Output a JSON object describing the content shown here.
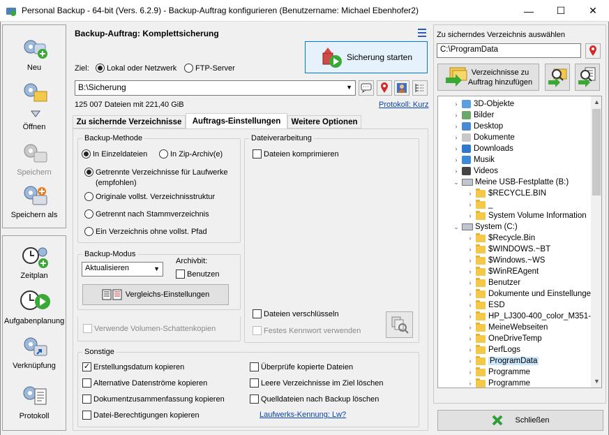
{
  "window": {
    "title": "Personal Backup - 64-bit (Vers. 6.2.9) - Backup-Auftrag konfigurieren (Benutzername: Michael Ebenhofer2)",
    "minimize": "—",
    "maximize": "☐",
    "close": "✕"
  },
  "sidebar": {
    "top": [
      {
        "label": "Neu",
        "icon": "new-job-icon"
      },
      {
        "label": "Öffnen",
        "icon": "open-job-icon"
      },
      {
        "label": "Speichern",
        "icon": "save-icon",
        "disabled": true
      },
      {
        "label": "Speichern als",
        "icon": "save-as-icon"
      }
    ],
    "bottom": [
      {
        "label": "Zeitplan",
        "icon": "schedule-icon"
      },
      {
        "label": "Aufgabenplanung",
        "icon": "task-scheduler-icon"
      },
      {
        "label": "Verknüpfung",
        "icon": "shortcut-icon"
      },
      {
        "label": "Protokoll",
        "icon": "log-icon"
      }
    ]
  },
  "job": {
    "title": "Backup-Auftrag: Komplettsicherung",
    "start_label": "Sicherung starten",
    "target_label": "Ziel:",
    "target_local": "Lokal oder Netzwerk",
    "target_ftp": "FTP-Server",
    "target_path": "B:\\Sicherung",
    "stats": "125 007 Dateien mit 221,40 GiB",
    "log_link": "Protokoll: Kurz"
  },
  "tabs": [
    {
      "label": "Zu sichernde Verzeichnisse",
      "active": false
    },
    {
      "label": "Auftrags-Einstellungen",
      "active": true
    },
    {
      "label": "Weitere Optionen",
      "active": false
    }
  ],
  "backup_method": {
    "title": "Backup-Methode",
    "single_files": "In Einzeldateien",
    "zip_archive": "In Zip-Archiv(e)",
    "separate_dirs": "Getrennte Verzeichnisse für Laufwerke",
    "separate_dirs_note": "(empfohlen)",
    "original_structure": "Originale vollst. Verzeichnisstruktur",
    "separate_root": "Getrennt nach Stammverzeichnis",
    "single_dir": "Ein Verzeichnis ohne vollst. Pfad"
  },
  "backup_mode": {
    "title": "Backup-Modus",
    "selected": "Aktualisieren",
    "archive_bit_label": "Archivbit:",
    "use_archive_bit": "Benutzen",
    "compare_button": "Vergleichs-Einstellungen"
  },
  "shadow_copy": "Verwende Volumen-Schattenkopien",
  "file_processing": {
    "title": "Dateiverarbeitung",
    "compress": "Dateien komprimieren",
    "encrypt": "Dateien verschlüsseln",
    "fixed_password": "Festes Kennwort verwenden"
  },
  "misc": {
    "title": "Sonstige",
    "copy_creation_date": "Erstellungsdatum kopieren",
    "alt_streams": "Alternative Datenströme kopieren",
    "doc_summary": "Dokumentzusammenfassung kopieren",
    "file_permissions": "Datei-Berechtigungen kopieren",
    "verify_copies": "Überprüfe kopierte Dateien",
    "delete_empty_dirs": "Leere Verzeichnisse im Ziel löschen",
    "delete_source": "Quelldateien nach Backup löschen",
    "drive_id_link": "Laufwerks-Kennung: Lw?"
  },
  "right_panel": {
    "title": "Zu sicherndes Verzeichnis auswählen",
    "path": "C:\\ProgramData",
    "add_dirs_button": "Verzeichnisse zu\nAuftrag hinzufügen",
    "close_button": "Schließen",
    "tree": [
      {
        "label": "3D-Objekte",
        "level": 1,
        "type": "special"
      },
      {
        "label": "Bilder",
        "level": 1,
        "type": "special"
      },
      {
        "label": "Desktop",
        "level": 1,
        "type": "special"
      },
      {
        "label": "Dokumente",
        "level": 1,
        "type": "special"
      },
      {
        "label": "Downloads",
        "level": 1,
        "type": "special"
      },
      {
        "label": "Musik",
        "level": 1,
        "type": "special"
      },
      {
        "label": "Videos",
        "level": 1,
        "type": "special"
      },
      {
        "label": "Meine USB-Festplatte (B:)",
        "level": 1,
        "type": "drive",
        "expanded": true
      },
      {
        "label": "$RECYCLE.BIN",
        "level": 2,
        "type": "folder"
      },
      {
        "label": "_",
        "level": 2,
        "type": "folder"
      },
      {
        "label": "System Volume Information",
        "level": 2,
        "type": "folder"
      },
      {
        "label": "System (C:)",
        "level": 1,
        "type": "drive",
        "expanded": true
      },
      {
        "label": "$Recycle.Bin",
        "level": 2,
        "type": "folder"
      },
      {
        "label": "$WINDOWS.~BT",
        "level": 2,
        "type": "folder"
      },
      {
        "label": "$Windows.~WS",
        "level": 2,
        "type": "folder"
      },
      {
        "label": "$WinREAgent",
        "level": 2,
        "type": "folder"
      },
      {
        "label": "Benutzer",
        "level": 2,
        "type": "folder"
      },
      {
        "label": "Dokumente und Einstellunge",
        "level": 2,
        "type": "folder"
      },
      {
        "label": "ESD",
        "level": 2,
        "type": "folder"
      },
      {
        "label": "HP_LJ300-400_color_M351-",
        "level": 2,
        "type": "folder"
      },
      {
        "label": "MeineWebseiten",
        "level": 2,
        "type": "folder"
      },
      {
        "label": "OneDriveTemp",
        "level": 2,
        "type": "folder"
      },
      {
        "label": "PerfLogs",
        "level": 2,
        "type": "folder"
      },
      {
        "label": "ProgramData",
        "level": 2,
        "type": "folder",
        "selected": true
      },
      {
        "label": "Programme",
        "level": 2,
        "type": "folder"
      },
      {
        "label": "Programme",
        "level": 2,
        "type": "folder"
      }
    ]
  },
  "colors": {
    "accent_green": "#3aa835",
    "link_blue": "#0645ad",
    "selection": "#cce8ff",
    "folder_yellow": "#f3c94a"
  }
}
